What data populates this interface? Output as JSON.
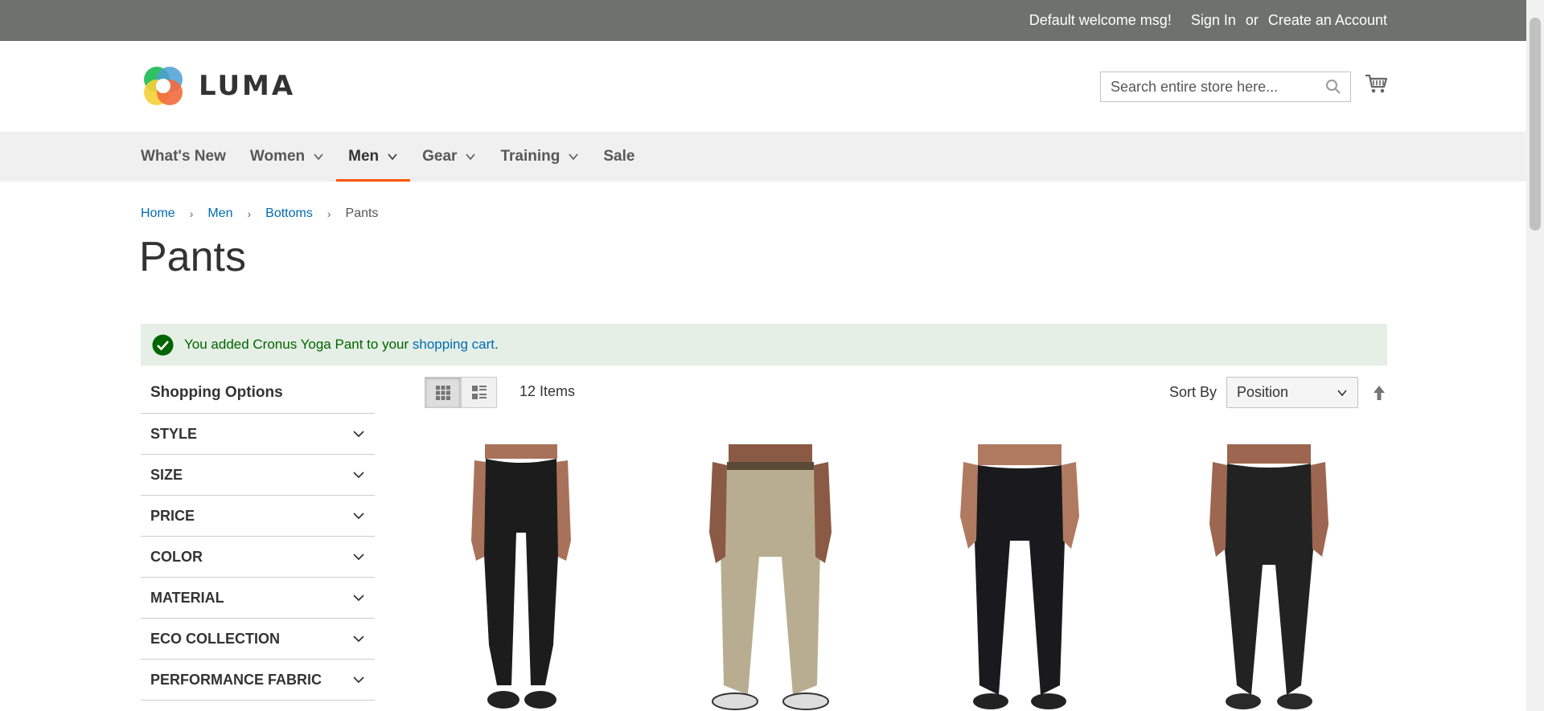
{
  "topbar": {
    "welcome": "Default welcome msg!",
    "sign_in": "Sign In",
    "or": "or",
    "create_account": "Create an Account"
  },
  "header": {
    "logo_text": "LUMA",
    "search_placeholder": "Search entire store here..."
  },
  "nav": {
    "items": [
      {
        "label": "What's New"
      },
      {
        "label": "Women"
      },
      {
        "label": "Men"
      },
      {
        "label": "Gear"
      },
      {
        "label": "Training"
      },
      {
        "label": "Sale"
      }
    ]
  },
  "breadcrumb": {
    "items": [
      "Home",
      "Men",
      "Bottoms"
    ],
    "current": "Pants"
  },
  "page": {
    "title": "Pants"
  },
  "message": {
    "prefix": "You added Cronus Yoga Pant to your ",
    "link": "shopping cart",
    "suffix": "."
  },
  "sidebar": {
    "title": "Shopping Options",
    "filters": [
      "STYLE",
      "SIZE",
      "PRICE",
      "COLOR",
      "MATERIAL",
      "ECO COLLECTION",
      "PERFORMANCE FABRIC"
    ]
  },
  "toolbar": {
    "count": "12 Items",
    "sort_label": "Sort By",
    "sort_value": "Position"
  },
  "products": [
    {
      "pant_color": "#1c1c1c",
      "skin": "#a8725a"
    },
    {
      "pant_color": "#b8ad90",
      "skin": "#8a5a44"
    },
    {
      "pant_color": "#1a1a1e",
      "skin": "#b07a60"
    },
    {
      "pant_color": "#222222",
      "skin": "#9c6650"
    }
  ],
  "colors": {
    "accent": "#ff5501",
    "link": "#006bb4",
    "success_bg": "#e5efe5",
    "success_icon": "#006400",
    "topbar": "#6e716e"
  }
}
